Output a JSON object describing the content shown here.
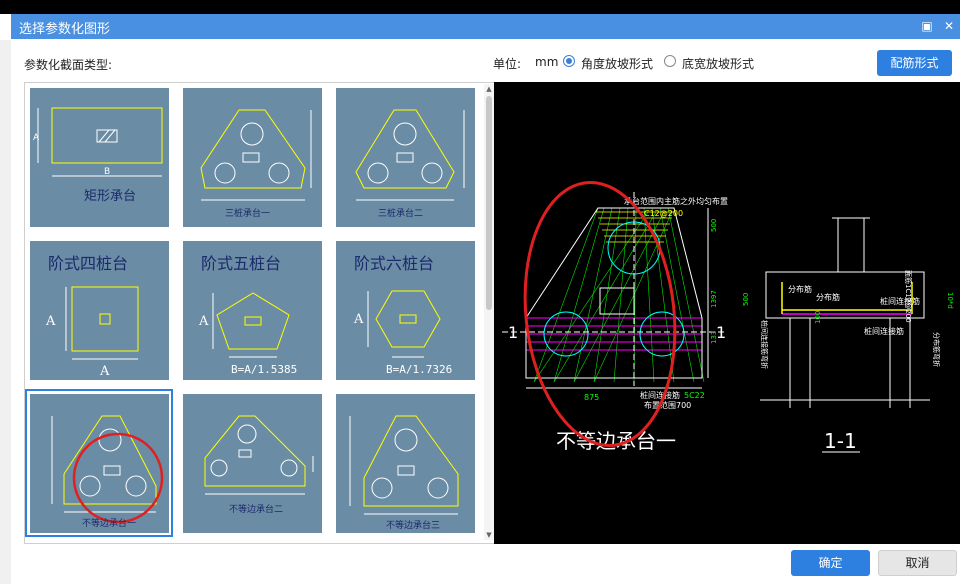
{
  "dialog": {
    "title": "选择参数化图形",
    "maximize_icon": "maximize-icon",
    "close_icon": "close-icon"
  },
  "section_label": "参数化截面类型:",
  "unit": {
    "label": "单位:",
    "value": "mm",
    "options": [
      {
        "label": "角度放坡形式",
        "selected": true
      },
      {
        "label": "底宽放坡形式",
        "selected": false
      }
    ]
  },
  "rebar_button": "配筋形式",
  "ok_button": "确定",
  "cancel_button": "取消",
  "shapes": [
    {
      "caption": "矩形承台",
      "selected": false
    },
    {
      "caption": "三桩承台一",
      "selected": false
    },
    {
      "caption": "三桩承台二",
      "selected": false
    },
    {
      "caption": "阶式四桩台",
      "selected": false,
      "formula": ""
    },
    {
      "caption": "阶式五桩台",
      "selected": false,
      "formula": "B=A/1.5385"
    },
    {
      "caption": "阶式六桩台",
      "selected": false,
      "formula": "B=A/1.7326"
    },
    {
      "caption": "不等边承台一",
      "selected": true
    },
    {
      "caption": "不等边承台二",
      "selected": false
    },
    {
      "caption": "不等边承台三",
      "selected": false
    }
  ],
  "preview": {
    "title": "不等边承台一",
    "section_label": "1-1",
    "marker_left": "1",
    "marker_right": "1",
    "annotations": {
      "top_note": "承台范围内主筋之外均匀布置",
      "top_bar": "C12@200",
      "bottom_note": "桩间连接筋",
      "bottom_bar": "5C22",
      "range_text": "布置范围700",
      "dim_500": "500",
      "dim_1397": "1397",
      "dim_133": "133",
      "dim_875": "875",
      "side_fenbu": "分布筋",
      "side_fenbu2": "分布筋",
      "side_lianjie": "桩间连接筋",
      "side_lianjie2": "桩间连接筋",
      "side_right1": "面筋1C12@200",
      "side_right2": "分布筋弯折",
      "side_right3": "10*d",
      "side_left": "桩间连接筋弯折",
      "side_dim": "500",
      "side_dim2": "100"
    }
  },
  "colors": {
    "titlebar": "#4a90e2",
    "accent": "#2d7fe0",
    "thumb_bg": "#6b8ca5",
    "shape_line": "#ffff00",
    "annotation_red": "#e02020"
  }
}
